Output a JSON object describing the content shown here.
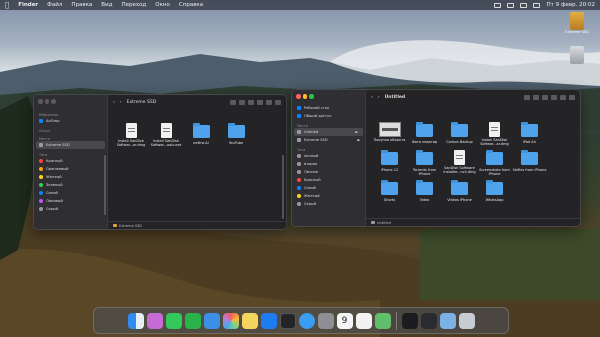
{
  "menubar": {
    "apple": "",
    "app": "Finder",
    "items": [
      "Файл",
      "Правка",
      "Вид",
      "Переход",
      "Окно",
      "Справка"
    ],
    "clock": "Пт 9 февр.  20:02"
  },
  "desktop": {
    "drive_label": "Extreme SSD"
  },
  "window_left": {
    "title": "Extreme SSD",
    "sidebar": {
      "sections": [
        {
          "header": "Избранное",
          "items": [
            {
              "label": "AirDrop",
              "icon": "airdrop-icon"
            }
          ]
        },
        {
          "header": "iCloud",
          "items": []
        },
        {
          "header": "Места",
          "items": [
            {
              "label": "Extreme SSD",
              "icon": "drive-icon",
              "selected": true
            }
          ]
        },
        {
          "header": "Теги",
          "items": [
            {
              "label": "Красный",
              "color": "#ff453a"
            },
            {
              "label": "Оранжевый",
              "color": "#ff9f0a"
            },
            {
              "label": "Желтый",
              "color": "#ffd60a"
            },
            {
              "label": "Зеленый",
              "color": "#30d158"
            },
            {
              "label": "Синий",
              "color": "#0a84ff"
            },
            {
              "label": "Лиловый",
              "color": "#bf5af2"
            },
            {
              "label": "Серый",
              "color": "#98989d"
            }
          ]
        }
      ]
    },
    "files": [
      {
        "name": "Install SanDisk Softwar...ar.dmg",
        "kind": "doc"
      },
      {
        "name": "Install SanDisk Softwar...ools.exe",
        "kind": "doc"
      },
      {
        "name": "кейти.AI",
        "kind": "folder"
      },
      {
        "name": "YouTube",
        "kind": "folder"
      }
    ],
    "path": "Extreme SSD"
  },
  "window_right": {
    "title": "Untitled",
    "sidebar": {
      "sections": [
        {
          "header": "",
          "items": [
            {
              "label": "Рабочий стол",
              "icon": "desktop-icon"
            },
            {
              "label": "Общий доступ",
              "icon": "shared-icon"
            }
          ]
        },
        {
          "header": "Места",
          "items": [
            {
              "label": "Untitled",
              "icon": "drive-icon",
              "selected": true,
              "eject": "⏏"
            },
            {
              "label": "Extreme SSD",
              "icon": "drive-icon",
              "eject": "⏏"
            }
          ]
        },
        {
          "header": "Теги",
          "items": [
            {
              "label": "личный",
              "color": "#9a9aa0"
            },
            {
              "label": "вторая",
              "color": "#9a9aa0"
            },
            {
              "label": "Личное",
              "color": "#9a9aa0"
            },
            {
              "label": "Красный",
              "color": "#ff453a"
            },
            {
              "label": "Синий",
              "color": "#0a84ff"
            },
            {
              "label": "Желтый",
              "color": "#ffd60a"
            },
            {
              "label": "Серый",
              "color": "#98989d"
            }
          ]
        }
      ]
    },
    "files": [
      {
        "name": "Покупка объекта",
        "kind": "image"
      },
      {
        "name": "Фото квартир",
        "kind": "folder"
      },
      {
        "name": "Carbon Backup",
        "kind": "folder"
      },
      {
        "name": "Install SanDisk Softwar...ar.dmg",
        "kind": "doc"
      },
      {
        "name": "iPad Air",
        "kind": "folder"
      },
      {
        "name": "iPhone 12",
        "kind": "folder"
      },
      {
        "name": "Torrents from iPhone",
        "kind": "folder"
      },
      {
        "name": "SanDisk Software Installer...ncil.dmg",
        "kind": "doc"
      },
      {
        "name": "Screenshots from iPhone",
        "kind": "folder"
      },
      {
        "name": "Selfies from iPhone",
        "kind": "folder"
      },
      {
        "name": "Shorts",
        "kind": "folder"
      },
      {
        "name": "Video",
        "kind": "folder"
      },
      {
        "name": "Videos iPhone",
        "kind": "folder"
      },
      {
        "name": "WhatsApp",
        "kind": "folder"
      }
    ],
    "path": "Untitled"
  },
  "dock": {
    "apps": [
      {
        "name": "finder-icon",
        "color": "#2f8cf0"
      },
      {
        "name": "launchpad-icon",
        "color": "#c56bd6"
      },
      {
        "name": "messages-icon",
        "color": "#34c759"
      },
      {
        "name": "facetime-icon",
        "color": "#28b44a"
      },
      {
        "name": "mail-icon",
        "color": "#3b8fe8"
      },
      {
        "name": "photos-icon",
        "color": "#f6b93b"
      },
      {
        "name": "notes-icon",
        "color": "#f4d35e"
      },
      {
        "name": "appstore-icon",
        "color": "#1e7cf2"
      },
      {
        "name": "tv-icon",
        "color": "#222428"
      },
      {
        "name": "safari-icon",
        "color": "#3a9df2"
      },
      {
        "name": "settings-icon",
        "color": "#8e8e93"
      },
      {
        "name": "calendar-icon",
        "color": "#f5f5f5"
      },
      {
        "name": "reminders-icon",
        "color": "#f2f2f2"
      },
      {
        "name": "maps-icon",
        "color": "#5fbf6a"
      },
      {
        "name": "downloads-icon",
        "color": "#1b1c20"
      },
      {
        "name": "apps-grid-icon",
        "color": "#2a2b30"
      },
      {
        "name": "folder-stack-icon",
        "color": "#7ab2e6"
      },
      {
        "name": "trash-icon",
        "color": "#c7ccd2"
      }
    ],
    "calendar_day": "9"
  }
}
